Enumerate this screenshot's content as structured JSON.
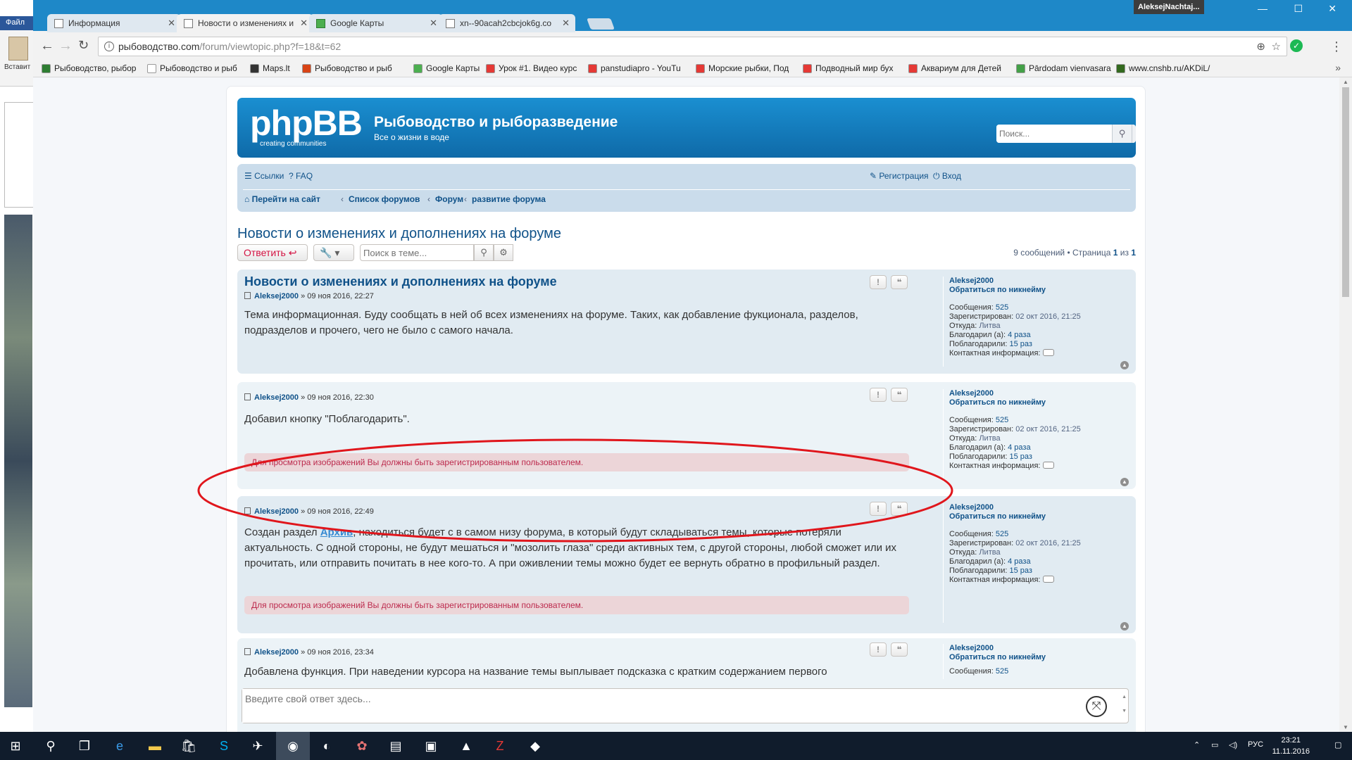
{
  "bg_app": {
    "file_tab": "Файл",
    "paste_label": "Вставит"
  },
  "window": {
    "user": "AleksejNachtaj...",
    "tabs": [
      {
        "label": "Информация"
      },
      {
        "label": "Новости о изменениях и"
      },
      {
        "label": "Google Карты"
      },
      {
        "label": "xn--90acah2cbcjok6g.co"
      }
    ]
  },
  "address": {
    "host": "рыбоводство.com",
    "path": "/forum/viewtopic.php?f=18&t=62"
  },
  "bookmarks": [
    {
      "label": "Рыбоводство, рыбор",
      "color": "#2e7d32"
    },
    {
      "label": "Рыбоводство и рыб",
      "color": "#ffffff"
    },
    {
      "label": "Maps.lt",
      "color": "#333333"
    },
    {
      "label": "Рыбоводство и рыб",
      "color": "#d84315"
    },
    {
      "label": "Google Карты",
      "color": "#4caf50"
    },
    {
      "label": "Урок #1. Видео курс",
      "color": "#e53935"
    },
    {
      "label": "panstudiapro - YouTu",
      "color": "#e53935"
    },
    {
      "label": "Морские рыбки, Под",
      "color": "#e53935"
    },
    {
      "label": "Подводный мир бух",
      "color": "#e53935"
    },
    {
      "label": "Аквариум для Детей",
      "color": "#e53935"
    },
    {
      "label": "Pārdodam vienvasara",
      "color": "#43a047"
    },
    {
      "label": "www.cnshb.ru/AKDiL/",
      "color": "#33691e"
    }
  ],
  "header": {
    "logo_big": "phpBB",
    "logo_small": "creating   communities",
    "title": "Рыбоводство и рыборазведение",
    "description": "Все о жизни в воде",
    "search_placeholder": "Поиск..."
  },
  "nav": {
    "links": "Ссылки",
    "faq": "FAQ",
    "register": "Регистрация",
    "login": "Вход",
    "crumbs": [
      "Перейти на сайт",
      "Список форумов",
      "Форум",
      "развитие форума"
    ]
  },
  "topic": {
    "title": "Новости о изменениях и дополнениях на форуме",
    "reply_button": "Ответить",
    "search_placeholder": "Поиск в теме...",
    "count_text": "9 сообщений • Страница",
    "page": "1",
    "of": "из",
    "pages": "1"
  },
  "profile_labels": {
    "mention": "Обратиться по никнейму",
    "posts": "Сообщения:",
    "registered": "Зарегистрирован:",
    "from": "Откуда:",
    "thanked": "Благодарил (а):",
    "was_thanked": "Поблагодарили:",
    "contact": "Контактная информация:"
  },
  "profile_values": {
    "user": "Aleksej2000",
    "posts": "525",
    "registered": "02 окт 2016, 21:25",
    "from": "Литва",
    "thanked": "4 раза",
    "was_thanked": "15 раз"
  },
  "posts": [
    {
      "subject": "Новости о изменениях и дополнениях на форуме",
      "author": "Aleksej2000",
      "date": "» 09 ноя 2016, 22:27",
      "body": "Тема информационная. Буду сообщать в ней об всех изменениях на форуме. Таких, как добавление фукционала, разделов, подразделов и прочего, чего не было с самого начала."
    },
    {
      "author": "Aleksej2000",
      "date": "» 09 ноя 2016, 22:30",
      "body": "Добавил кнопку \"Поблагодарить\".",
      "notice": "Для просмотра изображений Вы должны быть зарегистрированным пользователем."
    },
    {
      "author": "Aleksej2000",
      "date": "» 09 ноя 2016, 22:49",
      "body_pre": "Создан раздел ",
      "body_link": "Архив",
      "body_post": ", находиться будет с в самом низу форума, в который будут складываться темы, которые потеряли актуальность. С одной стороны, не будут мешаться и \"мозолить глаза\" среди активных тем, с другой стороны, любой сможет или их прочитать, или отправить почитать в нее кого-то. А при оживлении темы можно будет ее вернуть обратно в профильный раздел.",
      "notice": "Для просмотра изображений Вы должны быть зарегистрированным пользователем."
    },
    {
      "author": "Aleksej2000",
      "date": "» 09 ноя 2016, 23:34",
      "body": "Добавлена функция. При наведении курсора на название темы выплывает подсказка с кратким содержанием первого"
    }
  ],
  "reply": {
    "placeholder": "Введите свой ответ здесь..."
  },
  "taskbar": {
    "lang": "РУС",
    "time": "23:21",
    "date": "11.11.2016"
  },
  "colors": {
    "annotation": "#e0161c",
    "header_blue": "#1a8fd1",
    "link": "#105289"
  }
}
